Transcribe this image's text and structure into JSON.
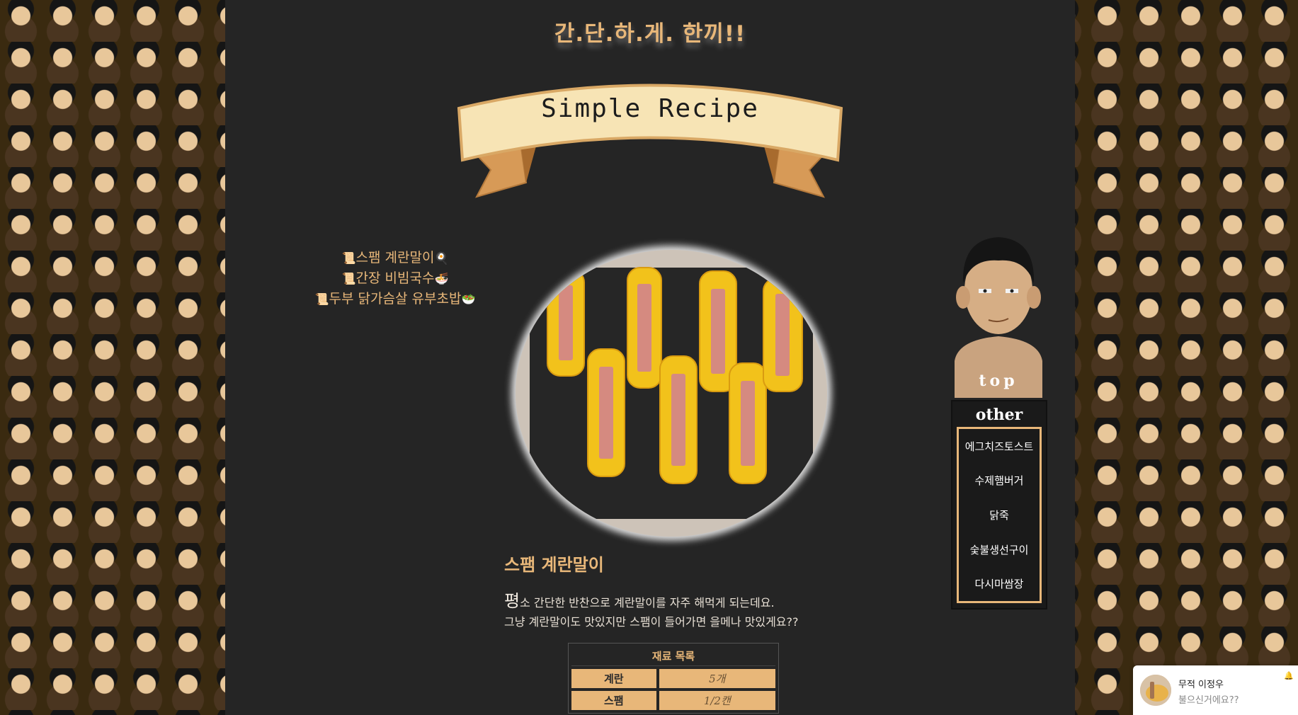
{
  "header": {
    "site_title": "간.단.하.게. 한끼!!",
    "banner_text": "Simple Recipe"
  },
  "nav": {
    "items": [
      {
        "prefix_icon": "scroll-icon",
        "label": "스팸 계란말이",
        "suffix_icon": "frying-pan-icon"
      },
      {
        "prefix_icon": "scroll-icon",
        "label": "간장 비빔국수",
        "suffix_icon": "noodle-bowl-icon"
      },
      {
        "prefix_icon": "scroll-icon",
        "label": "두부 닭가슴살 유부초밥",
        "suffix_icon": "salad-icon"
      }
    ]
  },
  "recipe": {
    "title": "스팸 계란말이",
    "intro_drop": "평",
    "intro_line1": "소 간단한 반찬으로 계란말이를 자주 해먹게 되는데요.",
    "intro_line2": "그냥 계란말이도 맛있지만 스팸이 들어가면 을메나 맛있게요??",
    "ingredients": {
      "header": "재료 목록",
      "rows": [
        {
          "name": "계란",
          "qty": "5개"
        },
        {
          "name": "스팸",
          "qty": "1/2캔"
        }
      ]
    }
  },
  "sidebar": {
    "top_label": "top",
    "other_title": "other",
    "other_items": [
      "에그치즈토스트",
      "수제햄버거",
      "닭죽",
      "숯불생선구이",
      "다시마쌈장"
    ]
  },
  "chat_toast": {
    "name": "무적 이정우",
    "message": "불으신거에요??"
  },
  "colors": {
    "accent": "#e8b779",
    "panel_bg": "#252525",
    "text_light": "#e8e0d5"
  }
}
